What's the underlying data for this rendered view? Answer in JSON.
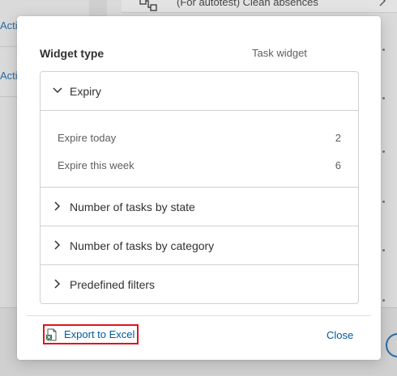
{
  "background": {
    "left_rows": [
      {
        "label": "Acti"
      },
      {
        "label": "Acti"
      }
    ],
    "top_card": {
      "label": "(For autotest) Clean absences"
    }
  },
  "dialog": {
    "widget_type_label": "Widget type",
    "widget_type_value": "Task widget",
    "sections": {
      "expiry": {
        "title": "Expiry",
        "expanded": true,
        "rows": [
          {
            "label": "Expire today",
            "value": "2"
          },
          {
            "label": "Expire this week",
            "value": "6"
          }
        ]
      },
      "by_state": {
        "title": "Number of tasks by state",
        "expanded": false
      },
      "by_category": {
        "title": "Number of tasks by category",
        "expanded": false
      },
      "filters": {
        "title": "Predefined filters",
        "expanded": false
      }
    },
    "footer": {
      "export_label": "Export to Excel",
      "close_label": "Close"
    }
  },
  "colors": {
    "link": "#005a9e",
    "highlight_border": "#e0141e",
    "text": "#323130",
    "muted_text": "#605e5c"
  },
  "icons": {
    "section_collapsed": "chevron-right-icon",
    "section_expanded": "chevron-down-icon",
    "export": "excel-file-icon",
    "top_card": "workflow-icon"
  }
}
